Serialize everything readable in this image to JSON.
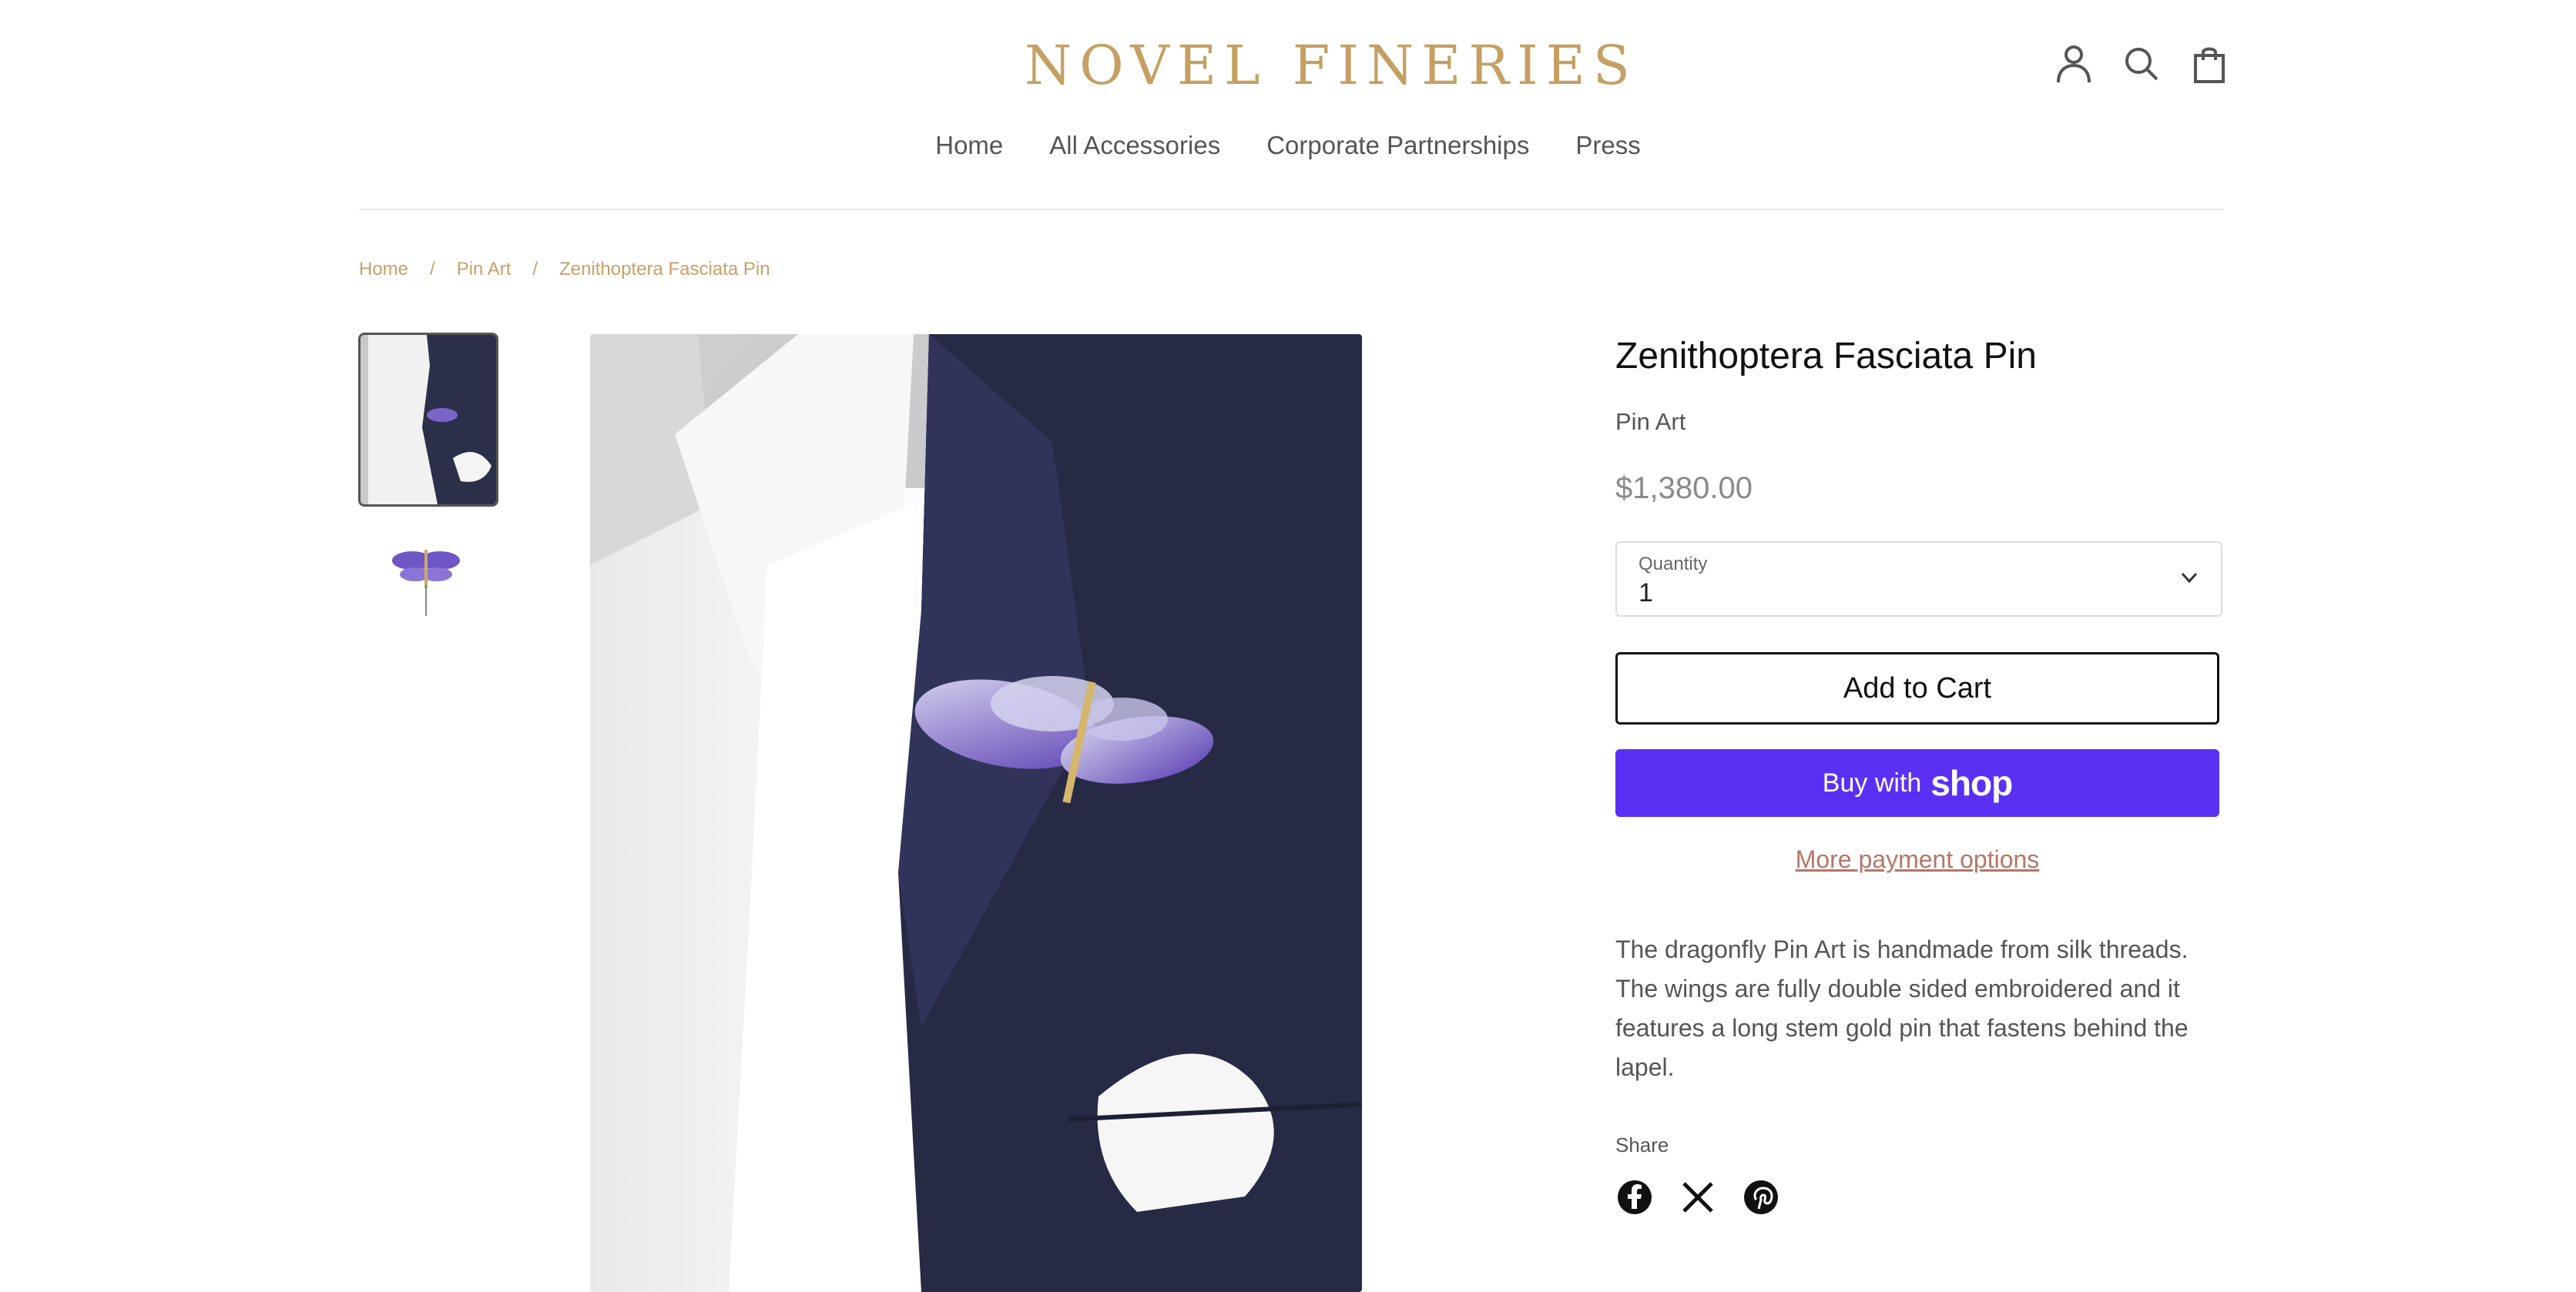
{
  "brand": {
    "name": "NOVEL  FINERIES"
  },
  "nav": {
    "items": [
      "Home",
      "All Accessories",
      "Corporate Partnerships",
      "Press"
    ]
  },
  "header_icons": [
    "account-icon",
    "search-icon",
    "cart-icon"
  ],
  "breadcrumb": {
    "items": [
      "Home",
      "Pin Art",
      "Zenithoptera Fasciata Pin"
    ],
    "separator": "/"
  },
  "product": {
    "title": "Zenithoptera Fasciata Pin",
    "vendor": "Pin Art",
    "price": "$1,380.00",
    "quantity_label": "Quantity",
    "quantity_value": "1",
    "add_to_cart": "Add to Cart",
    "buy_with": "Buy with",
    "shop": "shop",
    "more_payment": "More payment options",
    "description": "The dragonfly Pin Art is handmade from silk threads. The wings are fully double sided embroidered and it features a long stem gold pin that fastens behind the lapel.",
    "share_label": "Share"
  },
  "social": [
    "facebook-icon",
    "x-icon",
    "pinterest-icon"
  ],
  "colors": {
    "brand_gold": "#c4a063",
    "shop_purple": "#5a31f4",
    "link_rose": "#b77567"
  }
}
